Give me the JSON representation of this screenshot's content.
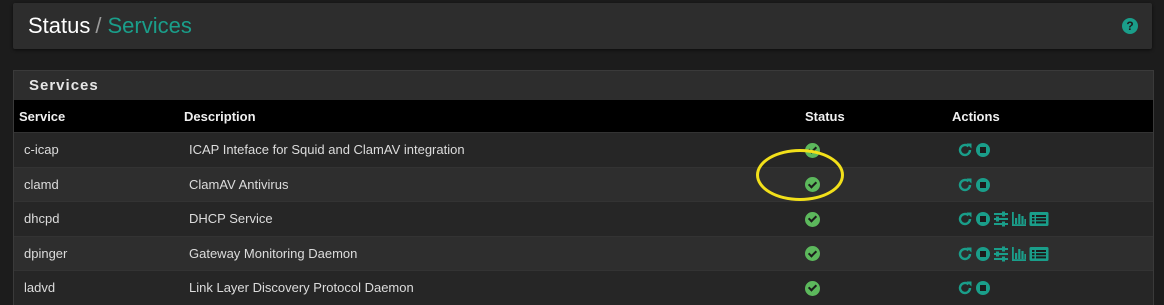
{
  "breadcrumb": {
    "root": "Status",
    "separator": "/",
    "current": "Services"
  },
  "header": {
    "help_icon": "question-circle-icon"
  },
  "panel": {
    "title": "Services"
  },
  "table": {
    "columns": {
      "service": "Service",
      "description": "Description",
      "status": "Status",
      "actions": "Actions"
    },
    "rows": [
      {
        "service": "c-icap",
        "description": "ICAP Inteface for Squid and ClamAV integration",
        "status": "running",
        "actions": [
          "restart-icon",
          "stop-icon"
        ]
      },
      {
        "service": "clamd",
        "description": "ClamAV Antivirus",
        "status": "running",
        "actions": [
          "restart-icon",
          "stop-icon"
        ]
      },
      {
        "service": "dhcpd",
        "description": "DHCP Service",
        "status": "running",
        "actions": [
          "restart-icon",
          "stop-icon",
          "settings-sliders-icon",
          "status-chart-icon",
          "logs-list-icon"
        ]
      },
      {
        "service": "dpinger",
        "description": "Gateway Monitoring Daemon",
        "status": "running",
        "actions": [
          "restart-icon",
          "stop-icon",
          "settings-sliders-icon",
          "status-chart-icon",
          "logs-list-icon"
        ]
      },
      {
        "service": "ladvd",
        "description": "Link Layer Discovery Protocol Daemon",
        "status": "running",
        "actions": [
          "restart-icon",
          "stop-icon"
        ]
      }
    ]
  },
  "colors": {
    "accent": "#1a9e8a",
    "status_ok": "#5cb85c",
    "annotation": "#f2e01a"
  }
}
